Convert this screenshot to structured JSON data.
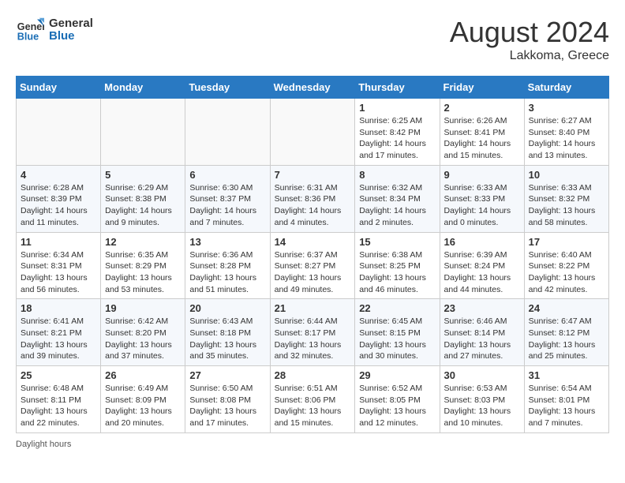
{
  "logo": {
    "line1": "General",
    "line2": "Blue"
  },
  "title": "August 2024",
  "location": "Lakkoma, Greece",
  "days_of_week": [
    "Sunday",
    "Monday",
    "Tuesday",
    "Wednesday",
    "Thursday",
    "Friday",
    "Saturday"
  ],
  "footer": "Daylight hours",
  "weeks": [
    [
      {
        "day": "",
        "info": ""
      },
      {
        "day": "",
        "info": ""
      },
      {
        "day": "",
        "info": ""
      },
      {
        "day": "",
        "info": ""
      },
      {
        "day": "1",
        "info": "Sunrise: 6:25 AM\nSunset: 8:42 PM\nDaylight: 14 hours and 17 minutes."
      },
      {
        "day": "2",
        "info": "Sunrise: 6:26 AM\nSunset: 8:41 PM\nDaylight: 14 hours and 15 minutes."
      },
      {
        "day": "3",
        "info": "Sunrise: 6:27 AM\nSunset: 8:40 PM\nDaylight: 14 hours and 13 minutes."
      }
    ],
    [
      {
        "day": "4",
        "info": "Sunrise: 6:28 AM\nSunset: 8:39 PM\nDaylight: 14 hours and 11 minutes."
      },
      {
        "day": "5",
        "info": "Sunrise: 6:29 AM\nSunset: 8:38 PM\nDaylight: 14 hours and 9 minutes."
      },
      {
        "day": "6",
        "info": "Sunrise: 6:30 AM\nSunset: 8:37 PM\nDaylight: 14 hours and 7 minutes."
      },
      {
        "day": "7",
        "info": "Sunrise: 6:31 AM\nSunset: 8:36 PM\nDaylight: 14 hours and 4 minutes."
      },
      {
        "day": "8",
        "info": "Sunrise: 6:32 AM\nSunset: 8:34 PM\nDaylight: 14 hours and 2 minutes."
      },
      {
        "day": "9",
        "info": "Sunrise: 6:33 AM\nSunset: 8:33 PM\nDaylight: 14 hours and 0 minutes."
      },
      {
        "day": "10",
        "info": "Sunrise: 6:33 AM\nSunset: 8:32 PM\nDaylight: 13 hours and 58 minutes."
      }
    ],
    [
      {
        "day": "11",
        "info": "Sunrise: 6:34 AM\nSunset: 8:31 PM\nDaylight: 13 hours and 56 minutes."
      },
      {
        "day": "12",
        "info": "Sunrise: 6:35 AM\nSunset: 8:29 PM\nDaylight: 13 hours and 53 minutes."
      },
      {
        "day": "13",
        "info": "Sunrise: 6:36 AM\nSunset: 8:28 PM\nDaylight: 13 hours and 51 minutes."
      },
      {
        "day": "14",
        "info": "Sunrise: 6:37 AM\nSunset: 8:27 PM\nDaylight: 13 hours and 49 minutes."
      },
      {
        "day": "15",
        "info": "Sunrise: 6:38 AM\nSunset: 8:25 PM\nDaylight: 13 hours and 46 minutes."
      },
      {
        "day": "16",
        "info": "Sunrise: 6:39 AM\nSunset: 8:24 PM\nDaylight: 13 hours and 44 minutes."
      },
      {
        "day": "17",
        "info": "Sunrise: 6:40 AM\nSunset: 8:22 PM\nDaylight: 13 hours and 42 minutes."
      }
    ],
    [
      {
        "day": "18",
        "info": "Sunrise: 6:41 AM\nSunset: 8:21 PM\nDaylight: 13 hours and 39 minutes."
      },
      {
        "day": "19",
        "info": "Sunrise: 6:42 AM\nSunset: 8:20 PM\nDaylight: 13 hours and 37 minutes."
      },
      {
        "day": "20",
        "info": "Sunrise: 6:43 AM\nSunset: 8:18 PM\nDaylight: 13 hours and 35 minutes."
      },
      {
        "day": "21",
        "info": "Sunrise: 6:44 AM\nSunset: 8:17 PM\nDaylight: 13 hours and 32 minutes."
      },
      {
        "day": "22",
        "info": "Sunrise: 6:45 AM\nSunset: 8:15 PM\nDaylight: 13 hours and 30 minutes."
      },
      {
        "day": "23",
        "info": "Sunrise: 6:46 AM\nSunset: 8:14 PM\nDaylight: 13 hours and 27 minutes."
      },
      {
        "day": "24",
        "info": "Sunrise: 6:47 AM\nSunset: 8:12 PM\nDaylight: 13 hours and 25 minutes."
      }
    ],
    [
      {
        "day": "25",
        "info": "Sunrise: 6:48 AM\nSunset: 8:11 PM\nDaylight: 13 hours and 22 minutes."
      },
      {
        "day": "26",
        "info": "Sunrise: 6:49 AM\nSunset: 8:09 PM\nDaylight: 13 hours and 20 minutes."
      },
      {
        "day": "27",
        "info": "Sunrise: 6:50 AM\nSunset: 8:08 PM\nDaylight: 13 hours and 17 minutes."
      },
      {
        "day": "28",
        "info": "Sunrise: 6:51 AM\nSunset: 8:06 PM\nDaylight: 13 hours and 15 minutes."
      },
      {
        "day": "29",
        "info": "Sunrise: 6:52 AM\nSunset: 8:05 PM\nDaylight: 13 hours and 12 minutes."
      },
      {
        "day": "30",
        "info": "Sunrise: 6:53 AM\nSunset: 8:03 PM\nDaylight: 13 hours and 10 minutes."
      },
      {
        "day": "31",
        "info": "Sunrise: 6:54 AM\nSunset: 8:01 PM\nDaylight: 13 hours and 7 minutes."
      }
    ]
  ]
}
